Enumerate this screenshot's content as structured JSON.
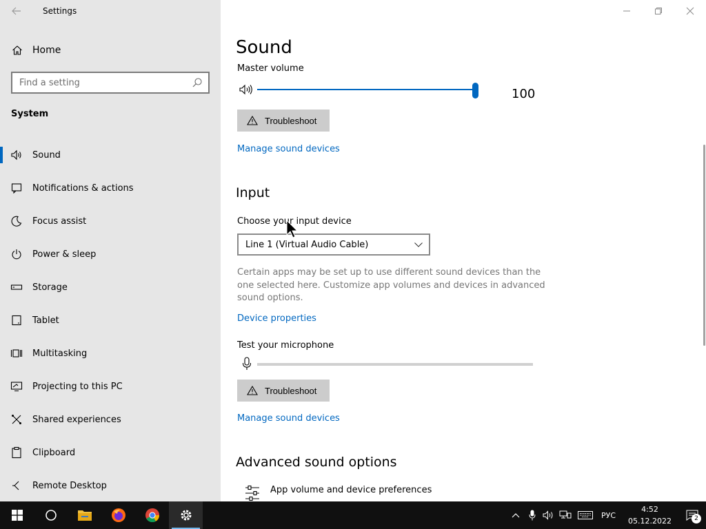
{
  "window": {
    "app_title": "Settings",
    "home_label": "Home",
    "search_placeholder": "Find a setting",
    "section_label": "System"
  },
  "sidebar": {
    "items": [
      {
        "label": "Sound",
        "icon": "speaker-icon",
        "active": true
      },
      {
        "label": "Notifications & actions",
        "icon": "notification-icon"
      },
      {
        "label": "Focus assist",
        "icon": "moon-icon"
      },
      {
        "label": "Power & sleep",
        "icon": "power-icon"
      },
      {
        "label": "Storage",
        "icon": "storage-icon"
      },
      {
        "label": "Tablet",
        "icon": "tablet-icon"
      },
      {
        "label": "Multitasking",
        "icon": "multitasking-icon"
      },
      {
        "label": "Projecting to this PC",
        "icon": "projecting-icon"
      },
      {
        "label": "Shared experiences",
        "icon": "shared-icon"
      },
      {
        "label": "Clipboard",
        "icon": "clipboard-icon"
      },
      {
        "label": "Remote Desktop",
        "icon": "remote-desktop-icon"
      }
    ]
  },
  "main": {
    "page_title": "Sound",
    "master_volume_label": "Master volume",
    "master_volume_value": "100",
    "master_volume_level": 1.0,
    "troubleshoot_label": "Troubleshoot",
    "manage_devices_label": "Manage sound devices",
    "input_heading": "Input",
    "choose_input_label": "Choose your input device",
    "input_device_selected": "Line 1 (Virtual Audio Cable)",
    "input_description": "Certain apps may be set up to use different sound devices than the one selected here. Customize app volumes and devices in advanced sound options.",
    "device_properties_label": "Device properties",
    "test_mic_label": "Test your microphone",
    "mic_level": 0,
    "troubleshoot2_label": "Troubleshoot",
    "manage_devices2_label": "Manage sound devices",
    "advanced_heading": "Advanced sound options",
    "app_volume_label": "App volume and device preferences"
  },
  "taskbar": {
    "apps": [
      "start-icon",
      "search-icon",
      "file-explorer-icon",
      "firefox-icon",
      "chrome-icon",
      "settings-icon"
    ],
    "language": "РУС",
    "time": "4:52",
    "date": "05.12.2022",
    "notification_count": "2"
  },
  "colors": {
    "accent": "#0067c0",
    "sidebar_bg": "#e6e6e6",
    "taskbar_bg": "#101010"
  }
}
